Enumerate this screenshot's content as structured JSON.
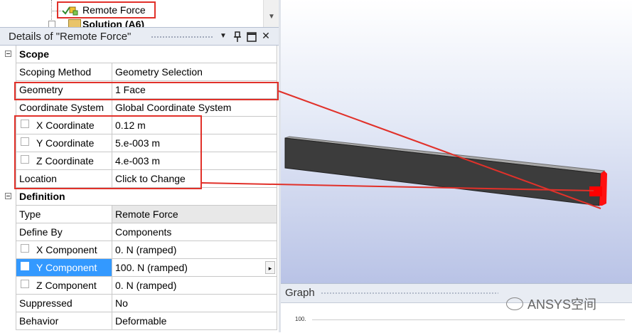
{
  "tree": {
    "item_label": "Remote Force",
    "next_item_label": "Solution (A6)"
  },
  "details": {
    "title": "Details of \"Remote Force\"",
    "toolbar": {
      "dropdown_icon": "▼",
      "pin_icon": "📌",
      "restore_icon": "□",
      "close_icon": "✕"
    },
    "sections": {
      "scope": "Scope",
      "definition": "Definition"
    },
    "rows": {
      "scoping_method": {
        "label": "Scoping Method",
        "value": "Geometry Selection"
      },
      "geometry": {
        "label": "Geometry",
        "value": "1 Face"
      },
      "coordinate_system": {
        "label": "Coordinate System",
        "value": "Global Coordinate System"
      },
      "x_coordinate": {
        "label": "X Coordinate",
        "value": "0.12 m"
      },
      "y_coordinate": {
        "label": "Y Coordinate",
        "value": "5.e-003 m"
      },
      "z_coordinate": {
        "label": "Z Coordinate",
        "value": "4.e-003 m"
      },
      "location": {
        "label": "Location",
        "value": "Click to Change"
      },
      "type": {
        "label": "Type",
        "value": "Remote Force"
      },
      "define_by": {
        "label": "Define By",
        "value": "Components"
      },
      "x_component": {
        "label": "X Component",
        "value": "0. N  (ramped)"
      },
      "y_component": {
        "label": "Y Component",
        "value": "100. N  (ramped)"
      },
      "z_component": {
        "label": "Z Component",
        "value": "0. N  (ramped)"
      },
      "suppressed": {
        "label": "Suppressed",
        "value": "No"
      },
      "behavior": {
        "label": "Behavior",
        "value": "Deformable"
      }
    }
  },
  "graph": {
    "title": "Graph",
    "y_tick": "100."
  },
  "watermark": "ANSYS空间",
  "colors": {
    "annotation_red": "#e1312a",
    "selection_blue": "#3399ff",
    "beam_top": "#9a9a9a",
    "beam_side": "#3b3b3b",
    "force_face": "#ff0000"
  }
}
